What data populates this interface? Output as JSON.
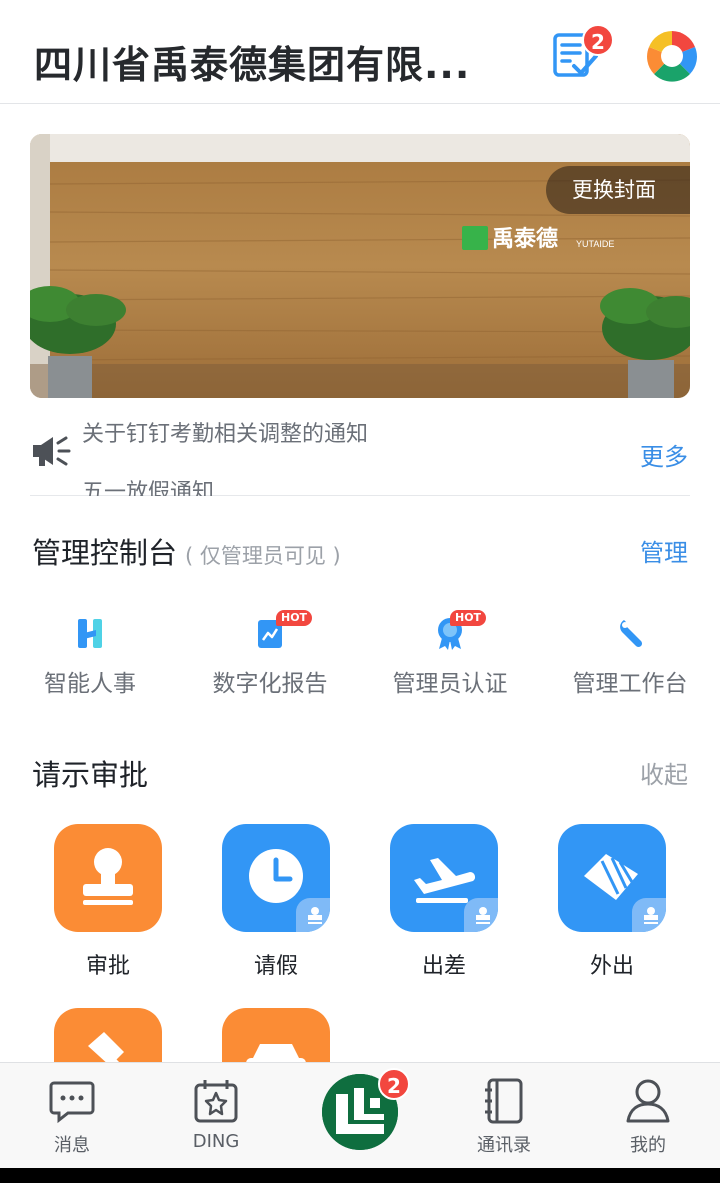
{
  "header": {
    "org_name": "四川省禹泰德集团有限...",
    "todo_badge": "2",
    "todo_icon": "todo-checklist-icon",
    "app_logo_icon": "dingtalk-workspace-logo-icon"
  },
  "banner": {
    "change_cover_label": "更换封面",
    "wall_brand_text": "禹泰德",
    "wall_brand_sub": "YUTAIDE"
  },
  "notice": {
    "icon": "megaphone-icon",
    "line1": "关于钉钉考勤相关调整的通知",
    "line2": "五一放假通知",
    "more_label": "更多"
  },
  "admin": {
    "title": "管理控制台",
    "subtitle": "( 仅管理员可见 )",
    "action_label": "管理",
    "items": [
      {
        "label": "智能人事",
        "icon": "smart-hr-icon",
        "hot": ""
      },
      {
        "label": "数字化报告",
        "icon": "digital-report-icon",
        "hot": "HOT"
      },
      {
        "label": "管理员认证",
        "icon": "admin-certification-icon",
        "hot": "HOT"
      },
      {
        "label": "管理工作台",
        "icon": "wrench-icon",
        "hot": ""
      }
    ]
  },
  "approvals": {
    "title": "请示审批",
    "action_label": "收起",
    "items": [
      {
        "label": "审批",
        "icon": "stamp-icon",
        "color": "#fb8c35"
      },
      {
        "label": "请假",
        "icon": "clock-icon",
        "color": "#3296f5"
      },
      {
        "label": "出差",
        "icon": "airplane-takeoff-icon",
        "color": "#3296f5"
      },
      {
        "label": "外出",
        "icon": "outing-icon",
        "color": "#3296f5"
      }
    ]
  },
  "tabbar": {
    "items": [
      {
        "label": "消息",
        "icon": "chat-bubble-icon"
      },
      {
        "label": "DING",
        "icon": "ding-calendar-icon"
      },
      {
        "label": "",
        "icon": "workspace-home-logo-icon"
      },
      {
        "label": "通讯录",
        "icon": "contacts-book-icon"
      },
      {
        "label": "我的",
        "icon": "person-icon"
      }
    ],
    "home_badge": "2"
  },
  "colors": {
    "accent_blue": "#3a8ee6",
    "badge_red": "#f2473f",
    "orange_tile": "#fb8c35",
    "blue_tile": "#3296f5",
    "home_green": "#0f6e3f"
  }
}
